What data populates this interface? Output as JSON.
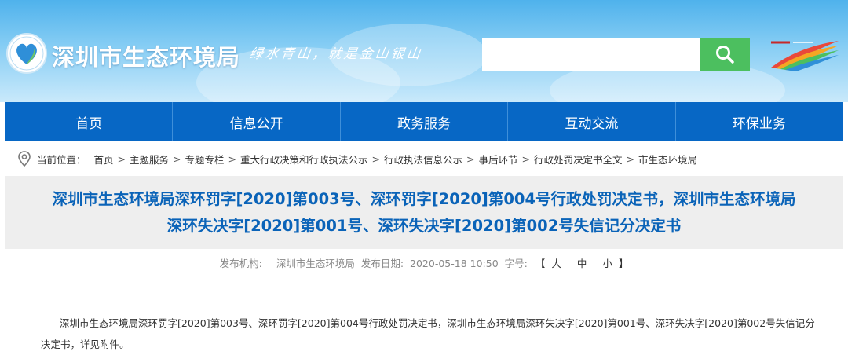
{
  "header": {
    "title": "深圳市生态环境局",
    "slogan": "绿水青山，就是金山银山",
    "search": {
      "placeholder": ""
    }
  },
  "nav": [
    {
      "label": "首页"
    },
    {
      "label": "信息公开"
    },
    {
      "label": "政务服务"
    },
    {
      "label": "互动交流"
    },
    {
      "label": "环保业务"
    }
  ],
  "breadcrumb": {
    "prefix": "当前位置：",
    "items": [
      "首页",
      "主题服务",
      "专题专栏",
      "重大行政决策和行政执法公示",
      "行政执法信息公示",
      "事后环节",
      "行政处罚决定书全文",
      "市生态环境局"
    ],
    "separator": ">"
  },
  "article": {
    "title_line1": "深圳市生态环境局深环罚字[2020]第003号、深环罚字[2020]第004号行政处罚决定书，深圳市生态环境局",
    "title_line2": "深环失决字[2020]第001号、深环失决字[2020]第002号失信记分决定书",
    "meta": {
      "publisher_label": "发布机构:",
      "publisher": "深圳市生态环境局",
      "date_label": "发布日期:",
      "date": "2020-05-18 10:50",
      "fontsize_label": "字号:",
      "bracket_open": "【",
      "size_large": "大",
      "size_medium": "中",
      "size_small": "小",
      "bracket_close": "】"
    },
    "body": "深圳市生态环境局深环罚字[2020]第003号、深环罚字[2020]第004号行政处罚决定书，深圳市生态环境局深环失决字[2020]第001号、深环失决字[2020]第002号失信记分决定书，详见附件。"
  },
  "colors": {
    "nav_bg": "#0767c5",
    "title": "#0a63b8",
    "search_button": "#4cbf5f"
  }
}
